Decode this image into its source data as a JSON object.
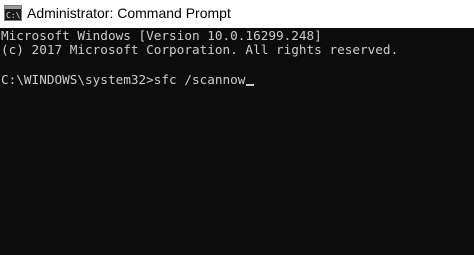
{
  "window": {
    "title": "Administrator: Command Prompt",
    "icon": "command-prompt-icon"
  },
  "console": {
    "lines": [
      "Microsoft Windows [Version 10.0.16299.248]",
      "(c) 2017 Microsoft Corporation. All rights reserved."
    ],
    "prompt": "C:\\WINDOWS\\system32>",
    "command": "sfc /scannow"
  },
  "colors": {
    "console_background": "#0c0c0c",
    "console_text": "#cccccc",
    "titlebar_background": "#ffffff"
  }
}
